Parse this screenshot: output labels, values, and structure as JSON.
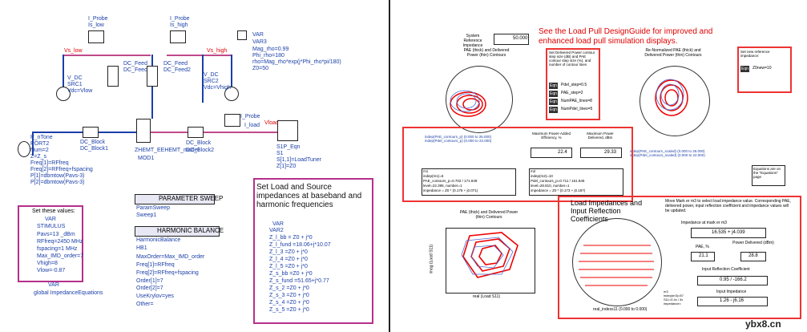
{
  "schematic": {
    "probes": [
      {
        "label_top": "I_Probe",
        "label_bottom": "Is_low"
      },
      {
        "label_top": "I_Probe",
        "label_bottom": "Is_high"
      },
      {
        "label_top": "I_Probe",
        "label_bottom": "I_load"
      }
    ],
    "nodes": {
      "vs_low": "Vs_low",
      "vs_high": "Vs_high",
      "vload": "Vload"
    },
    "var3": {
      "title": "VAR",
      "name": "VAR3",
      "lines": [
        "Mag_rho=0.99",
        "Phi_rho=180",
        "rho=Mag_rho*exp(j*Phi_rho*pi/180)",
        "Z0=50"
      ]
    },
    "feeds": [
      {
        "type": "DC_Feed",
        "name": "DC_Feed1"
      },
      {
        "type": "DC_Feed",
        "name": "DC_Feed2"
      }
    ],
    "src1": {
      "type": "V_DC",
      "name": "SRC1",
      "value": "Vdc=Vlow"
    },
    "src2": {
      "type": "V_DC",
      "name": "SRC2",
      "value": "Vdc=Vhigh"
    },
    "port": {
      "type": "P_nTone",
      "name": "PORT2",
      "lines": [
        "Num=2",
        "Z=Z_s",
        "Freq[1]=RFfreq",
        "Freq[2]=RFfreq+fspacing",
        "P[1]=dbmtow(Pavs-3)",
        "P[2]=dbmtow(Pavs-3)"
      ]
    },
    "blocks": [
      {
        "type": "DC_Block",
        "name": "DC_Block1"
      },
      {
        "type": "DC_Block",
        "name": "DC_Block2"
      }
    ],
    "device": {
      "name": "ZHEMT_EEHEMT_model",
      "ref": "MOD1"
    },
    "s1p": {
      "type": "S1P_Eqn",
      "name": "S1",
      "lines": [
        "S[1,1]=LoadTuner",
        "Z[1]=Z0"
      ]
    },
    "stimulus": {
      "header": "Set these values:",
      "title": "VAR",
      "name": "STIMULUS",
      "lines": [
        "Pavs=13 _dBm",
        "RFfreq=2450 MHz",
        "fspacing=1 MHz",
        "Max_IMD_order=7",
        "Vhigh=8",
        "Vlow=-0.87"
      ]
    },
    "global_var": {
      "title": "VAR",
      "name": "global ImpedanceEquations"
    },
    "param_sweep": {
      "label": "PARAMETER SWEEP",
      "sub": "ParamSweep",
      "name": "Sweep1"
    },
    "harmonic_balance": {
      "label": "HARMONIC BALANCE",
      "sub": "HarmonicBalance",
      "name": "HB1",
      "lines": [
        "MaxOrder=Max_IMD_order",
        "Freq[1]=RFfreq",
        "Freq[2]=RFfreq+fspacing",
        "Order[1]=7",
        "Order[2]=7",
        "UseKrylov=yes",
        "Other="
      ]
    },
    "impedance": {
      "heading": "Set Load and Source impedances at baseband and harmonic frequencies",
      "title": "VAR",
      "name": "VAR2",
      "lines": [
        "Z_l_bb = Z0 + j*0",
        "Z_l_fund =18.06+j*10.07",
        "Z_l_3 =Z0 + j*0",
        "Z_l_4 =Z0 + j*0",
        "Z_l_5 =Z0 + j*0",
        "Z_s_bb =Z0 + j*0",
        "Z_s_fund =51.65+j*0.77",
        "Z_s_2 =Z0 + j*0",
        "Z_s_3 =Z0 + j*0",
        "Z_s_4 =Z0 + j*0",
        "Z_s_5 =Z0 + j*0"
      ]
    }
  },
  "results": {
    "design_guide_note": "See the Load Pull DesignGuide for improved and enhanced load pull simulation displays.",
    "system_ref_label": "System Reference Impedance",
    "system_ref_value": "50.000",
    "pae_chart_title": "PAE (thick) and Delivered Power (thin) Contours",
    "pae_chart_xlabel": "indep(PAE_contours_p) (0.000 to 26.000)\nindep(Pdel_contours_p) (0.000 to 22.000)",
    "contour_settings": {
      "note": "Set Delivered Power contour step size (dB) and PAE contour step size (%), and number of contour lines",
      "items": [
        "Pdel_step=0.5",
        "PAE_step=2",
        "NumPAE_lines=8",
        "NumPdel_lines=5"
      ]
    },
    "renorm_chart_title": "Re-Normalized PAE (thick) and Delivered Power (thin) Contours",
    "renorm_xlabel": "indep(PAE_contours_scaled) (0.000 to 26.000)\nindep(Pdel_contours_scaled) (0.000 to 22.000)",
    "new_ref": {
      "note": "Set new reference impedance:",
      "value": "Z0new=10"
    },
    "equations_note": "Equations are on the \"Equations\" page",
    "max_pae_label": "Maximum Power-Added Efficiency, %",
    "max_pae_value": "22.4",
    "max_pdel_label": "Maximum Power Delivered, dBm",
    "max_pdel_value": "29.33",
    "marker_m1": [
      "m1",
      "indep(m1)=6",
      "PAE_contours_p=0.702 / 171.849",
      "level=22.395, number=1",
      "impedance = Z0 * (0.176 + j0.071)"
    ],
    "marker_m2": [
      "m2",
      "indep(m2)=10",
      "Pdel_contours_p=0.711 / 161.845",
      "level=28.810, number=1",
      "impedance = Z0 * (0.173 + j0.187)"
    ],
    "bottom_chart_title": "PAE (thick) and Delivered Power (thin) Contours",
    "bottom_chart_xlabel": "real (Load S11)",
    "bottom_chart_ylabel": "imag (Load S11)",
    "load_sim_title": "Load Impedances and Input Reflection Coefficients",
    "load_sim_xlabel": "real_indexs11 (0.000 to 0.000)",
    "marker_note": "Move Mark er m3 to select load impedance value. Corresponding PAE, delivered power, input reflection coefficient and impedance values will be updated.",
    "impedance_at_m3_label": "Impedance at mark er m3",
    "impedance_at_m3_value": "16.535 + j4.039",
    "pae_label": "PAE, %",
    "pae_value": "21.1",
    "power_label": "Power Delivered (dBm)",
    "power_value": "28.8",
    "input_refl_label": "Input Reflection Coefficient",
    "input_refl_value": "0.95 / -166.2",
    "input_imp_label": "Input Impedance",
    "input_imp_value": "1.26 - j6.16",
    "m3_text": [
      "m3",
      "indep(m3)=87",
      "S11=0.4x / 3x",
      "impedance="
    ]
  },
  "watermark": "ybx8.cn"
}
